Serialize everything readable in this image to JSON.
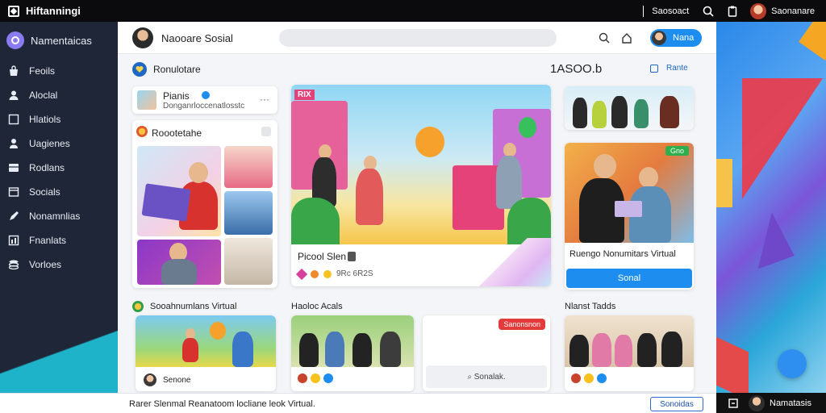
{
  "topbar": {
    "title": "Hiftanningi",
    "search_text": "Saosoact",
    "user_name": "Saonanare"
  },
  "sidebar": {
    "header_label": "Namentaicas",
    "items": [
      {
        "label": "Feoils",
        "icon": "bag-icon"
      },
      {
        "label": "Aloclal",
        "icon": "user-icon"
      },
      {
        "label": "Hlatiols",
        "icon": "square-icon"
      },
      {
        "label": "Uagienes",
        "icon": "person-icon"
      },
      {
        "label": "Rodlans",
        "icon": "grid-icon"
      },
      {
        "label": "Socials",
        "icon": "window-icon"
      },
      {
        "label": "Nonamnlias",
        "icon": "pen-icon"
      },
      {
        "label": "Fnanlats",
        "icon": "chart-icon"
      },
      {
        "label": "Vorloes",
        "icon": "stack-icon"
      }
    ]
  },
  "header": {
    "title": "Naooare Sosial",
    "pill_label": "Nana"
  },
  "section": {
    "title": "Ronulotare",
    "stat": "1ASOO.b",
    "link": "Rante"
  },
  "cards": {
    "profile": {
      "name": "Pianis",
      "subtitle": "Donganrloccenatlosstc"
    },
    "collage_title": "Roootetahe",
    "feature_title": "Picool Slen",
    "feature_badge": "RIX",
    "feature_meta": "9Rc 6R2S",
    "group_photo_alt": "group-photo",
    "promo_badge": "Gno",
    "promo_title": "Ruengo Nonumitars Virtual",
    "promo_button": "Sonal"
  },
  "row2": {
    "title_a": "Sooahnumlans Virtual",
    "title_b": "Haoloc Acals",
    "title_c": "Nlanst Tadds",
    "card1_label": "Senone",
    "card3_badge": "Sanonsnon",
    "card3_label": "Sonalak."
  },
  "bottombar": {
    "status": "Rarer Slenmal  Reanatoom locliane leok Virtual.",
    "button": "Sonoidas",
    "user_name": "Namatasis"
  },
  "colors": {
    "accent": "#1d8ef0",
    "sidebar": "#1f2638",
    "topbar": "#0b0b0d",
    "badge_red": "#e33b3b",
    "badge_green": "#2fae4d"
  }
}
